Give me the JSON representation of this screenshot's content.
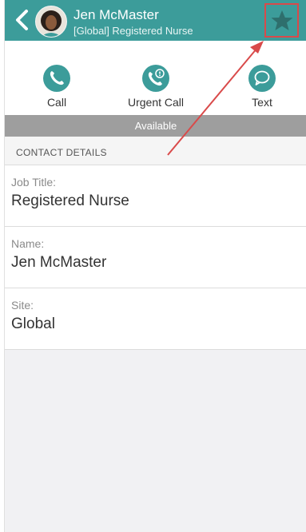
{
  "header": {
    "name": "Jen McMaster",
    "subtitle": "[Global] Registered Nurse",
    "back_icon": "chevron-left-icon",
    "favorite_icon": "star-icon",
    "color": "#3c9c9a"
  },
  "actions": [
    {
      "label": "Call",
      "icon": "phone-icon"
    },
    {
      "label": "Urgent Call",
      "icon": "urgent-phone-icon"
    },
    {
      "label": "Text",
      "icon": "chat-bubble-icon"
    }
  ],
  "status": {
    "label": "Available",
    "color": "#9e9e9e"
  },
  "section": {
    "title": "CONTACT DETAILS"
  },
  "details": [
    {
      "key": "Job Title:",
      "value": "Registered Nurse"
    },
    {
      "key": "Name:",
      "value": "Jen McMaster"
    },
    {
      "key": "Site:",
      "value": "Global"
    }
  ],
  "annotation": {
    "color": "#d94a4a"
  }
}
